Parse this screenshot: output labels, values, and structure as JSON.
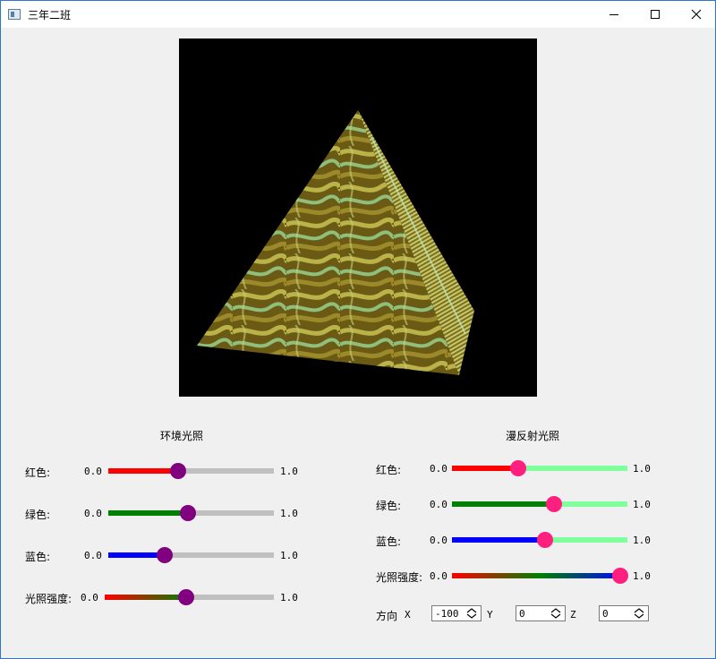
{
  "window": {
    "title": "三年二班"
  },
  "ambient": {
    "title": "环境光照",
    "rows": [
      {
        "label": "红色:",
        "min": "0.0",
        "max": "1.0",
        "value": 0.42,
        "fill": "#ff0000",
        "handle": "#800080",
        "track": "#c0c0c0"
      },
      {
        "label": "绿色:",
        "min": "0.0",
        "max": "1.0",
        "value": 0.48,
        "fill": "#008000",
        "handle": "#800080",
        "track": "#c0c0c0"
      },
      {
        "label": "蓝色:",
        "min": "0.0",
        "max": "1.0",
        "value": 0.34,
        "fill": "#0000ff",
        "handle": "#800080",
        "track": "#c0c0c0"
      },
      {
        "label": "光照强度:",
        "min": "0.0",
        "max": "1.0",
        "value": 0.48,
        "fill": "gradient",
        "handle": "#800080",
        "track": "#c0c0c0"
      }
    ]
  },
  "diffuse": {
    "title": "漫反射光照",
    "rows": [
      {
        "label": "红色:",
        "min": "0.0",
        "max": "1.0",
        "value": 0.38,
        "fill": "#ff0000",
        "handle": "#ff1f7f",
        "track": "#80ff9f"
      },
      {
        "label": "绿色:",
        "min": "0.0",
        "max": "1.0",
        "value": 0.58,
        "fill": "#008000",
        "handle": "#ff1f7f",
        "track": "#80ff9f"
      },
      {
        "label": "蓝色:",
        "min": "0.0",
        "max": "1.0",
        "value": 0.53,
        "fill": "#0000ff",
        "handle": "#ff1f7f",
        "track": "#80ff9f"
      },
      {
        "label": "光照强度:",
        "min": "0.0",
        "max": "1.0",
        "value": 0.96,
        "fill": "gradient",
        "handle": "#ff1f7f",
        "track": "#80ff9f"
      }
    ],
    "direction": {
      "label": "方向",
      "x_label": "X",
      "x_value": "-100",
      "y_label": "Y",
      "y_value": "0",
      "z_label": "Z",
      "z_value": "0"
    }
  }
}
